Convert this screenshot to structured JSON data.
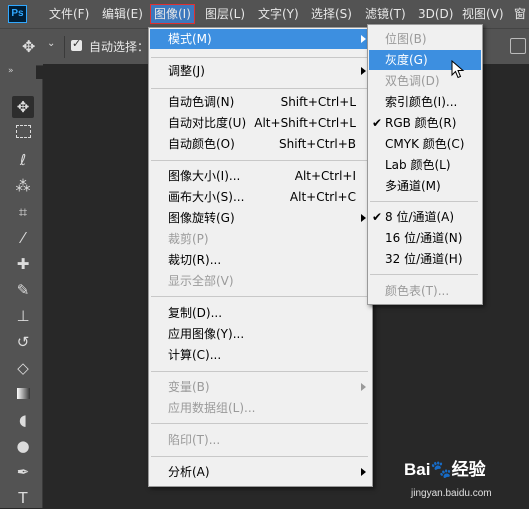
{
  "app": {
    "logo_text": "Ps"
  },
  "menubar": [
    {
      "label": "文件(F)"
    },
    {
      "label": "编辑(E)"
    },
    {
      "label": "图像(I)"
    },
    {
      "label": "图层(L)"
    },
    {
      "label": "文字(Y)"
    },
    {
      "label": "选择(S)"
    },
    {
      "label": "滤镜(T)"
    },
    {
      "label": "3D(D)"
    },
    {
      "label": "视图(V)"
    },
    {
      "label": "窗"
    }
  ],
  "options_bar": {
    "auto_select_label": "自动选择：",
    "auto_select_checked": true
  },
  "image_menu": {
    "items": [
      {
        "label": "模式(M)",
        "shortcut": "",
        "submenu": true,
        "disabled": false,
        "highlighted": true
      },
      {
        "label": "调整(J)",
        "shortcut": "",
        "submenu": true,
        "disabled": false
      },
      {
        "label": "自动色调(N)",
        "shortcut": "Shift+Ctrl+L",
        "disabled": false
      },
      {
        "label": "自动对比度(U)",
        "shortcut": "Alt+Shift+Ctrl+L",
        "disabled": false
      },
      {
        "label": "自动颜色(O)",
        "shortcut": "Shift+Ctrl+B",
        "disabled": false
      },
      {
        "label": "图像大小(I)...",
        "shortcut": "Alt+Ctrl+I",
        "disabled": false
      },
      {
        "label": "画布大小(S)...",
        "shortcut": "Alt+Ctrl+C",
        "disabled": false
      },
      {
        "label": "图像旋转(G)",
        "shortcut": "",
        "submenu": true,
        "disabled": false
      },
      {
        "label": "裁剪(P)",
        "shortcut": "",
        "disabled": true
      },
      {
        "label": "裁切(R)...",
        "shortcut": "",
        "disabled": false
      },
      {
        "label": "显示全部(V)",
        "shortcut": "",
        "disabled": true
      },
      {
        "label": "复制(D)...",
        "shortcut": "",
        "disabled": false
      },
      {
        "label": "应用图像(Y)...",
        "shortcut": "",
        "disabled": false
      },
      {
        "label": "计算(C)...",
        "shortcut": "",
        "disabled": false
      },
      {
        "label": "变量(B)",
        "shortcut": "",
        "submenu": true,
        "disabled": true
      },
      {
        "label": "应用数据组(L)...",
        "shortcut": "",
        "disabled": true
      },
      {
        "label": "陷印(T)...",
        "shortcut": "",
        "disabled": true
      },
      {
        "label": "分析(A)",
        "shortcut": "",
        "submenu": true,
        "disabled": false
      }
    ]
  },
  "mode_submenu": {
    "items": [
      {
        "label": "位图(B)",
        "disabled": true,
        "checked": false
      },
      {
        "label": "灰度(G)",
        "disabled": false,
        "checked": false,
        "highlighted": true
      },
      {
        "label": "双色调(D)",
        "disabled": true,
        "checked": false
      },
      {
        "label": "索引颜色(I)...",
        "disabled": false,
        "checked": false
      },
      {
        "label": "RGB 颜色(R)",
        "disabled": false,
        "checked": true
      },
      {
        "label": "CMYK 颜色(C)",
        "disabled": false,
        "checked": false
      },
      {
        "label": "Lab 颜色(L)",
        "disabled": false,
        "checked": false
      },
      {
        "label": "多通道(M)",
        "disabled": false,
        "checked": false
      },
      {
        "label": "8 位/通道(A)",
        "disabled": false,
        "checked": true
      },
      {
        "label": "16 位/通道(N)",
        "disabled": false,
        "checked": false
      },
      {
        "label": "32 位/通道(H)",
        "disabled": false,
        "checked": false
      },
      {
        "label": "颜色表(T)...",
        "disabled": true,
        "checked": false
      }
    ],
    "check_glyph": "✔"
  },
  "watermark": {
    "brand": "Bai",
    "brand2": "经验",
    "url": "jingyan.baidu.com"
  },
  "colors": {
    "highlight": "#3d8fe0",
    "menubar": "#535353",
    "menu_bg": "#f0f0f0",
    "disabled": "#9a9a9a"
  }
}
